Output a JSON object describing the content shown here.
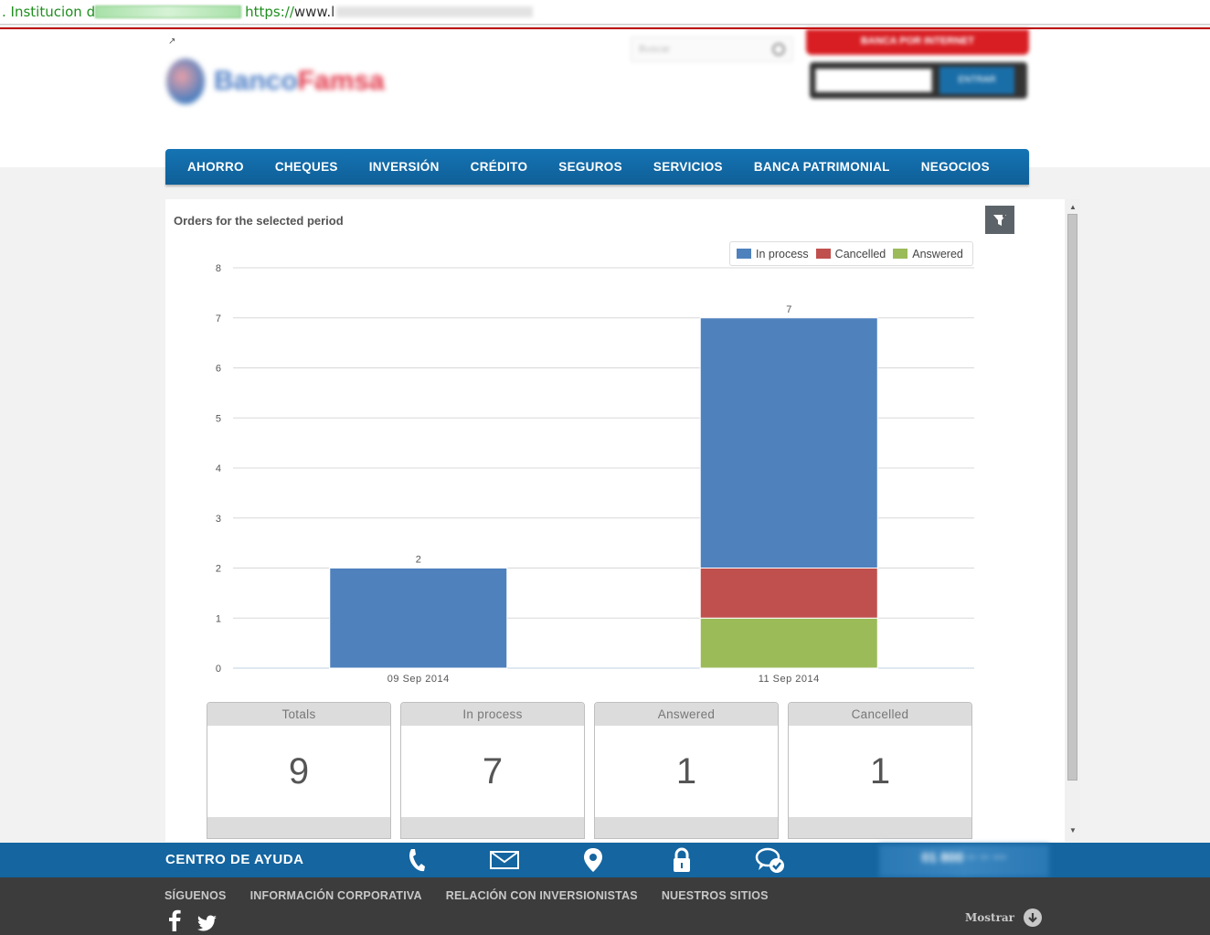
{
  "browser": {
    "ssl_label": ". Institucion d",
    "url_scheme": "https://",
    "url_text": "www.l"
  },
  "nav": {
    "items": [
      "AHORRO",
      "CHEQUES",
      "INVERSIÓN",
      "CRÉDITO",
      "SEGUROS",
      "SERVICIOS",
      "BANCA PATRIMONIAL",
      "NEGOCIOS"
    ]
  },
  "chart": {
    "title": "Orders for the selected period"
  },
  "chart_data": {
    "type": "bar",
    "stacked": true,
    "title": "Orders for the selected period",
    "categories": [
      "09 Sep 2014",
      "11 Sep 2014"
    ],
    "series": [
      {
        "name": "Answered",
        "values": [
          0,
          1
        ],
        "color": "#9bbb59"
      },
      {
        "name": "Cancelled",
        "values": [
          0,
          1
        ],
        "color": "#c0504d"
      },
      {
        "name": "In process",
        "values": [
          2,
          5
        ],
        "color": "#4f81bd"
      }
    ],
    "totals": [
      2,
      7
    ],
    "legend_order": [
      "In process",
      "Cancelled",
      "Answered"
    ],
    "legend_position": "top-right",
    "ylim": [
      0,
      8
    ],
    "yticks": [
      0,
      1,
      2,
      3,
      4,
      5,
      6,
      7,
      8
    ],
    "grid": true,
    "xlabel": "",
    "ylabel": ""
  },
  "stats": [
    {
      "label": "Totals",
      "value": "9"
    },
    {
      "label": "In process",
      "value": "7"
    },
    {
      "label": "Answered",
      "value": "1"
    },
    {
      "label": "Cancelled",
      "value": "1"
    }
  ],
  "help": {
    "title": "CENTRO DE AYUDA",
    "icons": [
      "phone-icon",
      "mail-icon",
      "location-icon",
      "lock-icon",
      "chat-icon"
    ]
  },
  "footer": {
    "links": [
      "SÍGUENOS",
      "INFORMACIÓN CORPORATIVA",
      "RELACIÓN CON INVERSIONISTAS",
      "NUESTROS SITIOS"
    ],
    "mostrar": "Mostrar"
  },
  "colors": {
    "nav": "#1574b4",
    "help_bar": "#1465a0",
    "footer": "#3c3c3c",
    "accent_red": "#d81e23"
  }
}
